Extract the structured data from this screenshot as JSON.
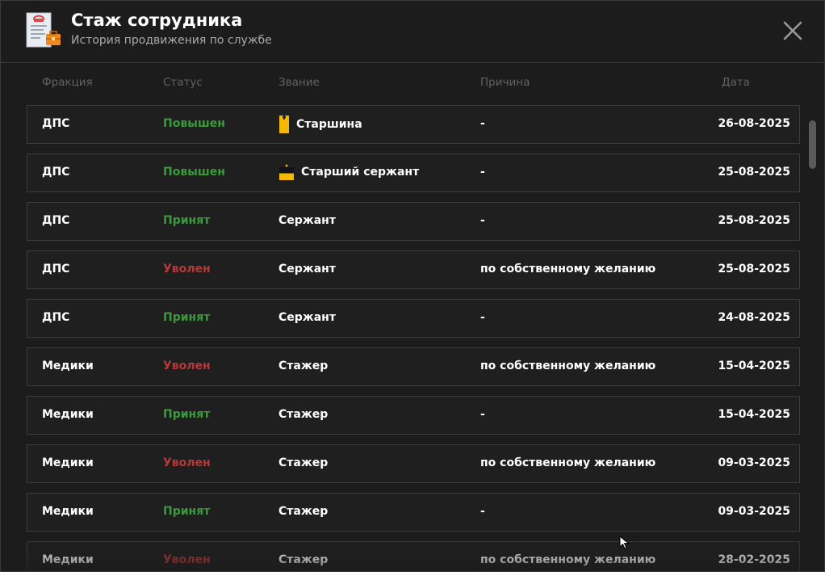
{
  "header": {
    "title": "Стаж сотрудника",
    "subtitle": "История продвижения по службе",
    "icon": "document-briefcase-icon",
    "close_icon": "close-icon"
  },
  "columns": {
    "faction": "Фракция",
    "status": "Статус",
    "rank": "Звание",
    "reason": "Причина",
    "date": "Дата"
  },
  "colors": {
    "background": "#1c1c1c",
    "row_border": "#3d3d3d",
    "promoted_hired": "#3a9a3c",
    "fired": "#b33a3a",
    "rank_badge": "#f5b800"
  },
  "rows": [
    {
      "faction": "ДПС",
      "status": "Повышен",
      "status_type": "green",
      "rank": "Старшина",
      "rank_icon": "starshina-badge-icon",
      "reason": "-",
      "date": "26-08-2025"
    },
    {
      "faction": "ДПС",
      "status": "Повышен",
      "status_type": "green",
      "rank": "Старший сержант",
      "rank_icon": "senior-sergeant-badge-icon",
      "reason": "-",
      "date": "25-08-2025"
    },
    {
      "faction": "ДПС",
      "status": "Принят",
      "status_type": "green",
      "rank": "Сержант",
      "rank_icon": "",
      "reason": "-",
      "date": "25-08-2025"
    },
    {
      "faction": "ДПС",
      "status": "Уволен",
      "status_type": "red",
      "rank": "Сержант",
      "rank_icon": "",
      "reason": "по собственному желанию",
      "date": "25-08-2025"
    },
    {
      "faction": "ДПС",
      "status": "Принят",
      "status_type": "green",
      "rank": "Сержант",
      "rank_icon": "",
      "reason": "-",
      "date": "24-08-2025"
    },
    {
      "faction": "Медики",
      "status": "Уволен",
      "status_type": "red",
      "rank": "Стажер",
      "rank_icon": "",
      "reason": "по собственному желанию",
      "date": "15-04-2025"
    },
    {
      "faction": "Медики",
      "status": "Принят",
      "status_type": "green",
      "rank": "Стажер",
      "rank_icon": "",
      "reason": "-",
      "date": "15-04-2025"
    },
    {
      "faction": "Медики",
      "status": "Уволен",
      "status_type": "red",
      "rank": "Стажер",
      "rank_icon": "",
      "reason": "по собственному желанию",
      "date": "09-03-2025"
    },
    {
      "faction": "Медики",
      "status": "Принят",
      "status_type": "green",
      "rank": "Стажер",
      "rank_icon": "",
      "reason": "-",
      "date": "09-03-2025"
    },
    {
      "faction": "Медики",
      "status": "Уволен",
      "status_type": "red",
      "rank": "Стажер",
      "rank_icon": "",
      "reason": "по собственному желанию",
      "date": "28-02-2025"
    }
  ]
}
